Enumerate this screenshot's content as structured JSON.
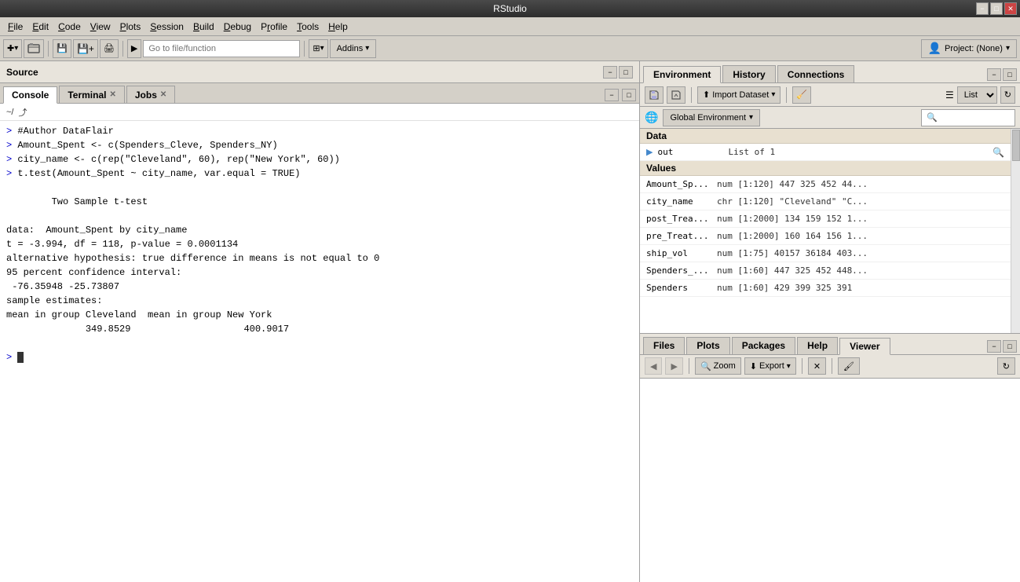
{
  "titlebar": {
    "title": "RStudio"
  },
  "menubar": {
    "items": [
      {
        "label": "File",
        "underline": "F"
      },
      {
        "label": "Edit",
        "underline": "E"
      },
      {
        "label": "Code",
        "underline": "C"
      },
      {
        "label": "View",
        "underline": "V"
      },
      {
        "label": "Plots",
        "underline": "P"
      },
      {
        "label": "Session",
        "underline": "S"
      },
      {
        "label": "Build",
        "underline": "B"
      },
      {
        "label": "Debug",
        "underline": "D"
      },
      {
        "label": "Profile",
        "underline": "r"
      },
      {
        "label": "Tools",
        "underline": "T"
      },
      {
        "label": "Help",
        "underline": "H"
      }
    ]
  },
  "toolbar": {
    "goto_placeholder": "Go to file/function",
    "addins_label": "Addins",
    "project_label": "Project: (None)"
  },
  "source": {
    "title": "Source"
  },
  "console_tabs": {
    "tabs": [
      {
        "label": "Console",
        "closeable": false
      },
      {
        "label": "Terminal",
        "closeable": true
      },
      {
        "label": "Jobs",
        "closeable": true
      }
    ],
    "active": 0
  },
  "console": {
    "path": "~/",
    "lines": [
      {
        "type": "prompt+command",
        "text": "> #Author DataFlair"
      },
      {
        "type": "prompt+command",
        "text": "> Amount_Spent <- c(Spenders_Cleve, Spenders_NY)"
      },
      {
        "type": "prompt+command",
        "text": "> city_name <- c(rep(\"Cleveland\", 60), rep(\"New York\", 60))"
      },
      {
        "type": "prompt+command",
        "text": "> t.test(Amount_Spent ~ city_name, var.equal = TRUE)"
      },
      {
        "type": "output",
        "text": ""
      },
      {
        "type": "output",
        "text": "\tTwo Sample t-test"
      },
      {
        "type": "output",
        "text": ""
      },
      {
        "type": "output",
        "text": "data:  Amount_Spent by city_name"
      },
      {
        "type": "output",
        "text": "t = -3.994, df = 118, p-value = 0.0001134"
      },
      {
        "type": "output",
        "text": "alternative hypothesis: true difference in means is not equal to 0"
      },
      {
        "type": "output",
        "text": "95 percent confidence interval:"
      },
      {
        "type": "output",
        "text": " -76.35948 -25.73807"
      },
      {
        "type": "output",
        "text": "sample estimates:"
      },
      {
        "type": "output",
        "text": "mean in group Cleveland  mean in group New York"
      },
      {
        "type": "output",
        "text": "              349.8529                400.9017"
      }
    ],
    "prompt_line": ">"
  },
  "env_tabs": {
    "tabs": [
      {
        "label": "Environment"
      },
      {
        "label": "History"
      },
      {
        "label": "Connections"
      }
    ],
    "active": 0
  },
  "env_toolbar": {
    "import_label": "Import Dataset",
    "list_label": "List",
    "broom_label": "🧹"
  },
  "env_selector": {
    "label": "Global Environment"
  },
  "environment": {
    "data_section": "Data",
    "values_section": "Values",
    "data_rows": [
      {
        "icon": "▶",
        "name": "out",
        "value": "List of 1"
      }
    ],
    "value_rows": [
      {
        "name": "Amount_Sp...",
        "value": "num [1:120] 447 325 452 44..."
      },
      {
        "name": "city_name",
        "value": "chr [1:120] \"Cleveland\" \"C..."
      },
      {
        "name": "post_Trea...",
        "value": "num [1:2000] 134 159 152 1..."
      },
      {
        "name": "pre_Treat...",
        "value": "num [1:2000] 160 164 156 1..."
      },
      {
        "name": "ship_vol",
        "value": "num [1:75] 40157 36184 403..."
      },
      {
        "name": "Spenders_...",
        "value": "num [1:60] 447 325 452 448..."
      },
      {
        "name": "Spenders",
        "value": "num [1:60] 429 399 325 391"
      }
    ]
  },
  "files_tabs": {
    "tabs": [
      {
        "label": "Files"
      },
      {
        "label": "Plots"
      },
      {
        "label": "Packages"
      },
      {
        "label": "Help"
      },
      {
        "label": "Viewer"
      }
    ],
    "active": 4
  },
  "files_toolbar": {
    "zoom_label": "Zoom",
    "export_label": "Export"
  }
}
